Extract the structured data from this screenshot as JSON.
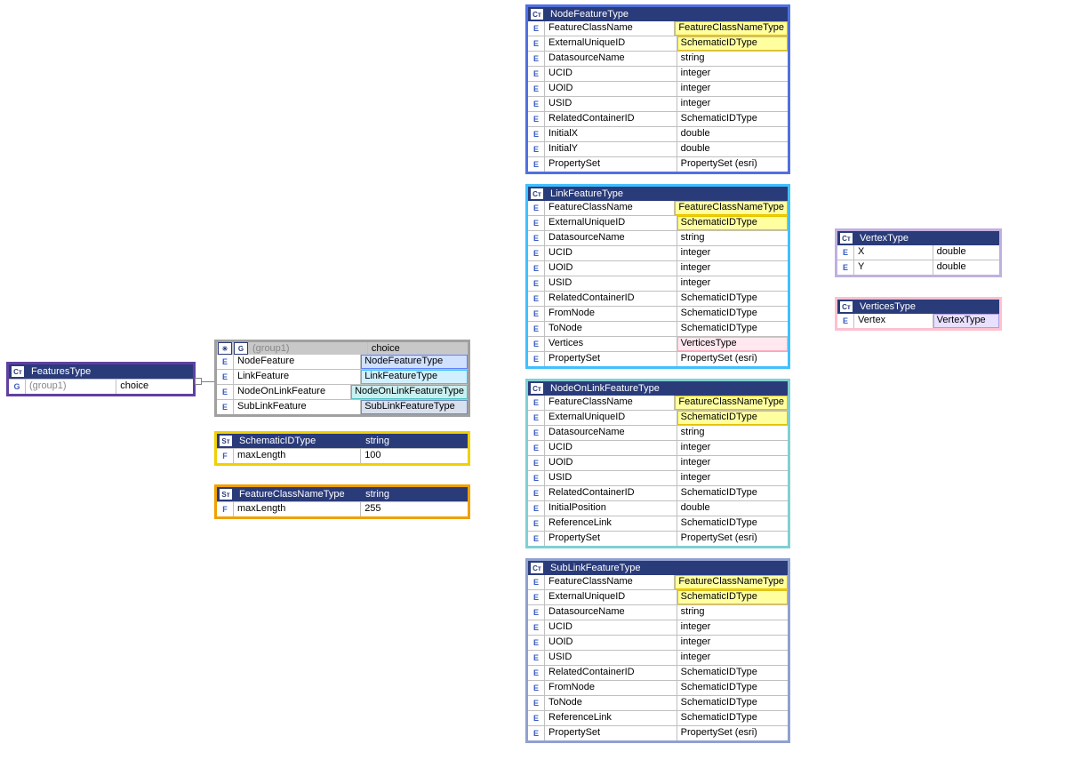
{
  "featuresType": {
    "title": "FeaturesType",
    "rows": [
      {
        "badge": "G",
        "name": "(group1)",
        "type": "choice"
      }
    ]
  },
  "group1": {
    "title": "(group1)",
    "titleType": "choice",
    "rows": [
      {
        "badge": "E",
        "name": "NodeFeature",
        "type": "NodeFeatureType",
        "hl": "blue"
      },
      {
        "badge": "E",
        "name": "LinkFeature",
        "type": "LinkFeatureType",
        "hl": "cyan"
      },
      {
        "badge": "E",
        "name": "NodeOnLinkFeature",
        "type": "NodeOnLinkFeatureType",
        "hl": "teal"
      },
      {
        "badge": "E",
        "name": "SubLinkFeature",
        "type": "SubLinkFeatureType",
        "hl": "slate"
      }
    ]
  },
  "schematicID": {
    "title": "SchematicIDType",
    "titleType": "string",
    "rows": [
      {
        "badge": "F",
        "name": "maxLength",
        "type": "100"
      }
    ]
  },
  "featureClassName": {
    "title": "FeatureClassNameType",
    "titleType": "string",
    "rows": [
      {
        "badge": "F",
        "name": "maxLength",
        "type": "255"
      }
    ]
  },
  "nodeFeature": {
    "title": "NodeFeatureType",
    "rows": [
      {
        "badge": "E",
        "name": "FeatureClassName",
        "type": "FeatureClassNameType",
        "hl": "yellow-orange"
      },
      {
        "badge": "E",
        "name": "ExternalUniqueID",
        "type": "SchematicIDType",
        "hl": "yellow"
      },
      {
        "badge": "E",
        "name": "DatasourceName",
        "type": "string"
      },
      {
        "badge": "E",
        "name": "UCID",
        "type": "integer"
      },
      {
        "badge": "E",
        "name": "UOID",
        "type": "integer"
      },
      {
        "badge": "E",
        "name": "USID",
        "type": "integer"
      },
      {
        "badge": "E",
        "name": "RelatedContainerID",
        "type": "SchematicIDType"
      },
      {
        "badge": "E",
        "name": "InitialX",
        "type": "double"
      },
      {
        "badge": "E",
        "name": "InitialY",
        "type": "double"
      },
      {
        "badge": "E",
        "name": "PropertySet",
        "type": "PropertySet (esri)"
      }
    ]
  },
  "linkFeature": {
    "title": "LinkFeatureType",
    "rows": [
      {
        "badge": "E",
        "name": "FeatureClassName",
        "type": "FeatureClassNameType",
        "hl": "yellow-orange"
      },
      {
        "badge": "E",
        "name": "ExternalUniqueID",
        "type": "SchematicIDType",
        "hl": "yellow"
      },
      {
        "badge": "E",
        "name": "DatasourceName",
        "type": "string"
      },
      {
        "badge": "E",
        "name": "UCID",
        "type": "integer"
      },
      {
        "badge": "E",
        "name": "UOID",
        "type": "integer"
      },
      {
        "badge": "E",
        "name": "USID",
        "type": "integer"
      },
      {
        "badge": "E",
        "name": "RelatedContainerID",
        "type": "SchematicIDType"
      },
      {
        "badge": "E",
        "name": "FromNode",
        "type": "SchematicIDType"
      },
      {
        "badge": "E",
        "name": "ToNode",
        "type": "SchematicIDType"
      },
      {
        "badge": "E",
        "name": "Vertices",
        "type": "VerticesType",
        "hl": "pink"
      },
      {
        "badge": "E",
        "name": "PropertySet",
        "type": "PropertySet (esri)"
      }
    ]
  },
  "nodeOnLink": {
    "title": "NodeOnLinkFeatureType",
    "rows": [
      {
        "badge": "E",
        "name": "FeatureClassName",
        "type": "FeatureClassNameType",
        "hl": "yellow-orange"
      },
      {
        "badge": "E",
        "name": "ExternalUniqueID",
        "type": "SchematicIDType",
        "hl": "yellow"
      },
      {
        "badge": "E",
        "name": "DatasourceName",
        "type": "string"
      },
      {
        "badge": "E",
        "name": "UCID",
        "type": "integer"
      },
      {
        "badge": "E",
        "name": "UOID",
        "type": "integer"
      },
      {
        "badge": "E",
        "name": "USID",
        "type": "integer"
      },
      {
        "badge": "E",
        "name": "RelatedContainerID",
        "type": "SchematicIDType"
      },
      {
        "badge": "E",
        "name": "InitialPosition",
        "type": "double"
      },
      {
        "badge": "E",
        "name": "ReferenceLink",
        "type": "SchematicIDType"
      },
      {
        "badge": "E",
        "name": "PropertySet",
        "type": "PropertySet (esri)"
      }
    ]
  },
  "subLink": {
    "title": "SubLinkFeatureType",
    "rows": [
      {
        "badge": "E",
        "name": "FeatureClassName",
        "type": "FeatureClassNameType",
        "hl": "yellow-orange"
      },
      {
        "badge": "E",
        "name": "ExternalUniqueID",
        "type": "SchematicIDType",
        "hl": "yellow"
      },
      {
        "badge": "E",
        "name": "DatasourceName",
        "type": "string"
      },
      {
        "badge": "E",
        "name": "UCID",
        "type": "integer"
      },
      {
        "badge": "E",
        "name": "UOID",
        "type": "integer"
      },
      {
        "badge": "E",
        "name": "USID",
        "type": "integer"
      },
      {
        "badge": "E",
        "name": "RelatedContainerID",
        "type": "SchematicIDType"
      },
      {
        "badge": "E",
        "name": "FromNode",
        "type": "SchematicIDType"
      },
      {
        "badge": "E",
        "name": "ToNode",
        "type": "SchematicIDType"
      },
      {
        "badge": "E",
        "name": "ReferenceLink",
        "type": "SchematicIDType"
      },
      {
        "badge": "E",
        "name": "PropertySet",
        "type": "PropertySet (esri)"
      }
    ]
  },
  "vertexType": {
    "title": "VertexType",
    "rows": [
      {
        "badge": "E",
        "name": "X",
        "type": "double"
      },
      {
        "badge": "E",
        "name": "Y",
        "type": "double"
      }
    ]
  },
  "verticesType": {
    "title": "VerticesType",
    "rows": [
      {
        "badge": "E",
        "name": "Vertex",
        "type": "VertexType",
        "hl": "lav"
      }
    ]
  },
  "badges": {
    "ct": "Cᴛ",
    "st": "Sᴛ",
    "g": "G",
    "e": "E",
    "f": "F",
    "tree": "✳"
  }
}
